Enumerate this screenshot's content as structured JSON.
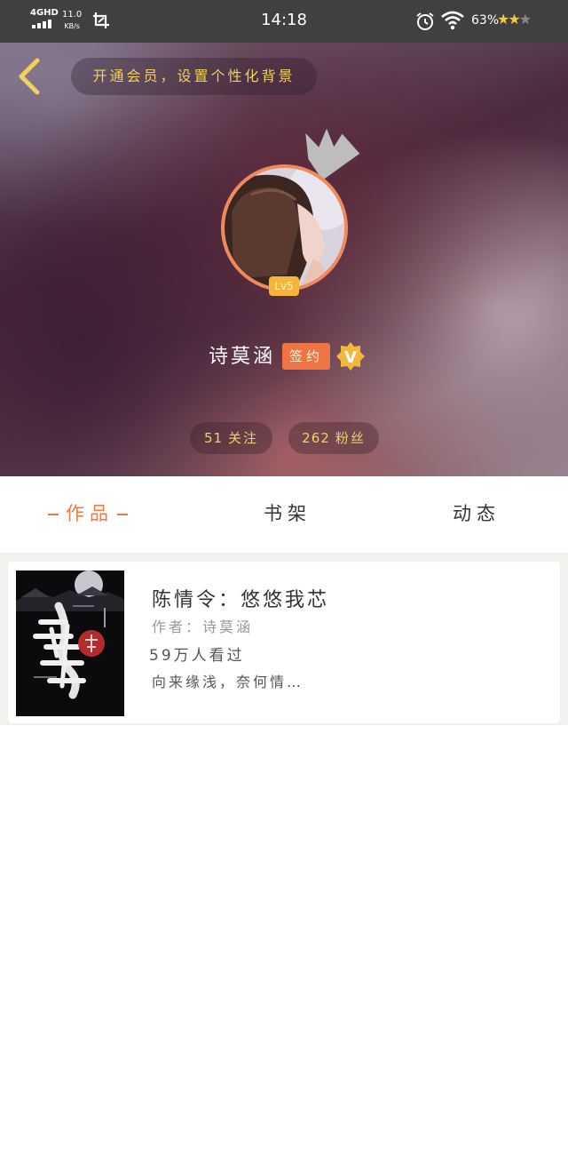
{
  "status_bar": {
    "network": "4GHD",
    "speed": "11.0",
    "speed_unit": "KB/s",
    "time": "14:18",
    "battery": "63%",
    "icons": [
      "signal-icon",
      "screenshot-icon",
      "alarm-icon",
      "wifi-icon",
      "star-icon"
    ]
  },
  "header": {
    "back_icon": "chevron-left-icon",
    "vip_prompt": "开通会员，设置个性化背景",
    "level": "Lv5",
    "username": "诗莫涵",
    "sign_label": "签约",
    "verified_mark": "V",
    "following_count": "51",
    "following_label": "关注",
    "fans_count": "262",
    "fans_label": "粉丝"
  },
  "tabs": {
    "active": "作品",
    "items": [
      "作品",
      "书架",
      "动态"
    ]
  },
  "works": [
    {
      "title": "陈情令：悠悠我芯",
      "author": "作者：诗莫涵",
      "views": "59万人看过",
      "description": "向来缘浅，奈何情…"
    }
  ],
  "colors": {
    "accent": "#f07a45",
    "gold": "#f3cf5e",
    "status_bar": "#404040",
    "sign_badge": "#f07443",
    "level_badge": "#f5b43a"
  }
}
